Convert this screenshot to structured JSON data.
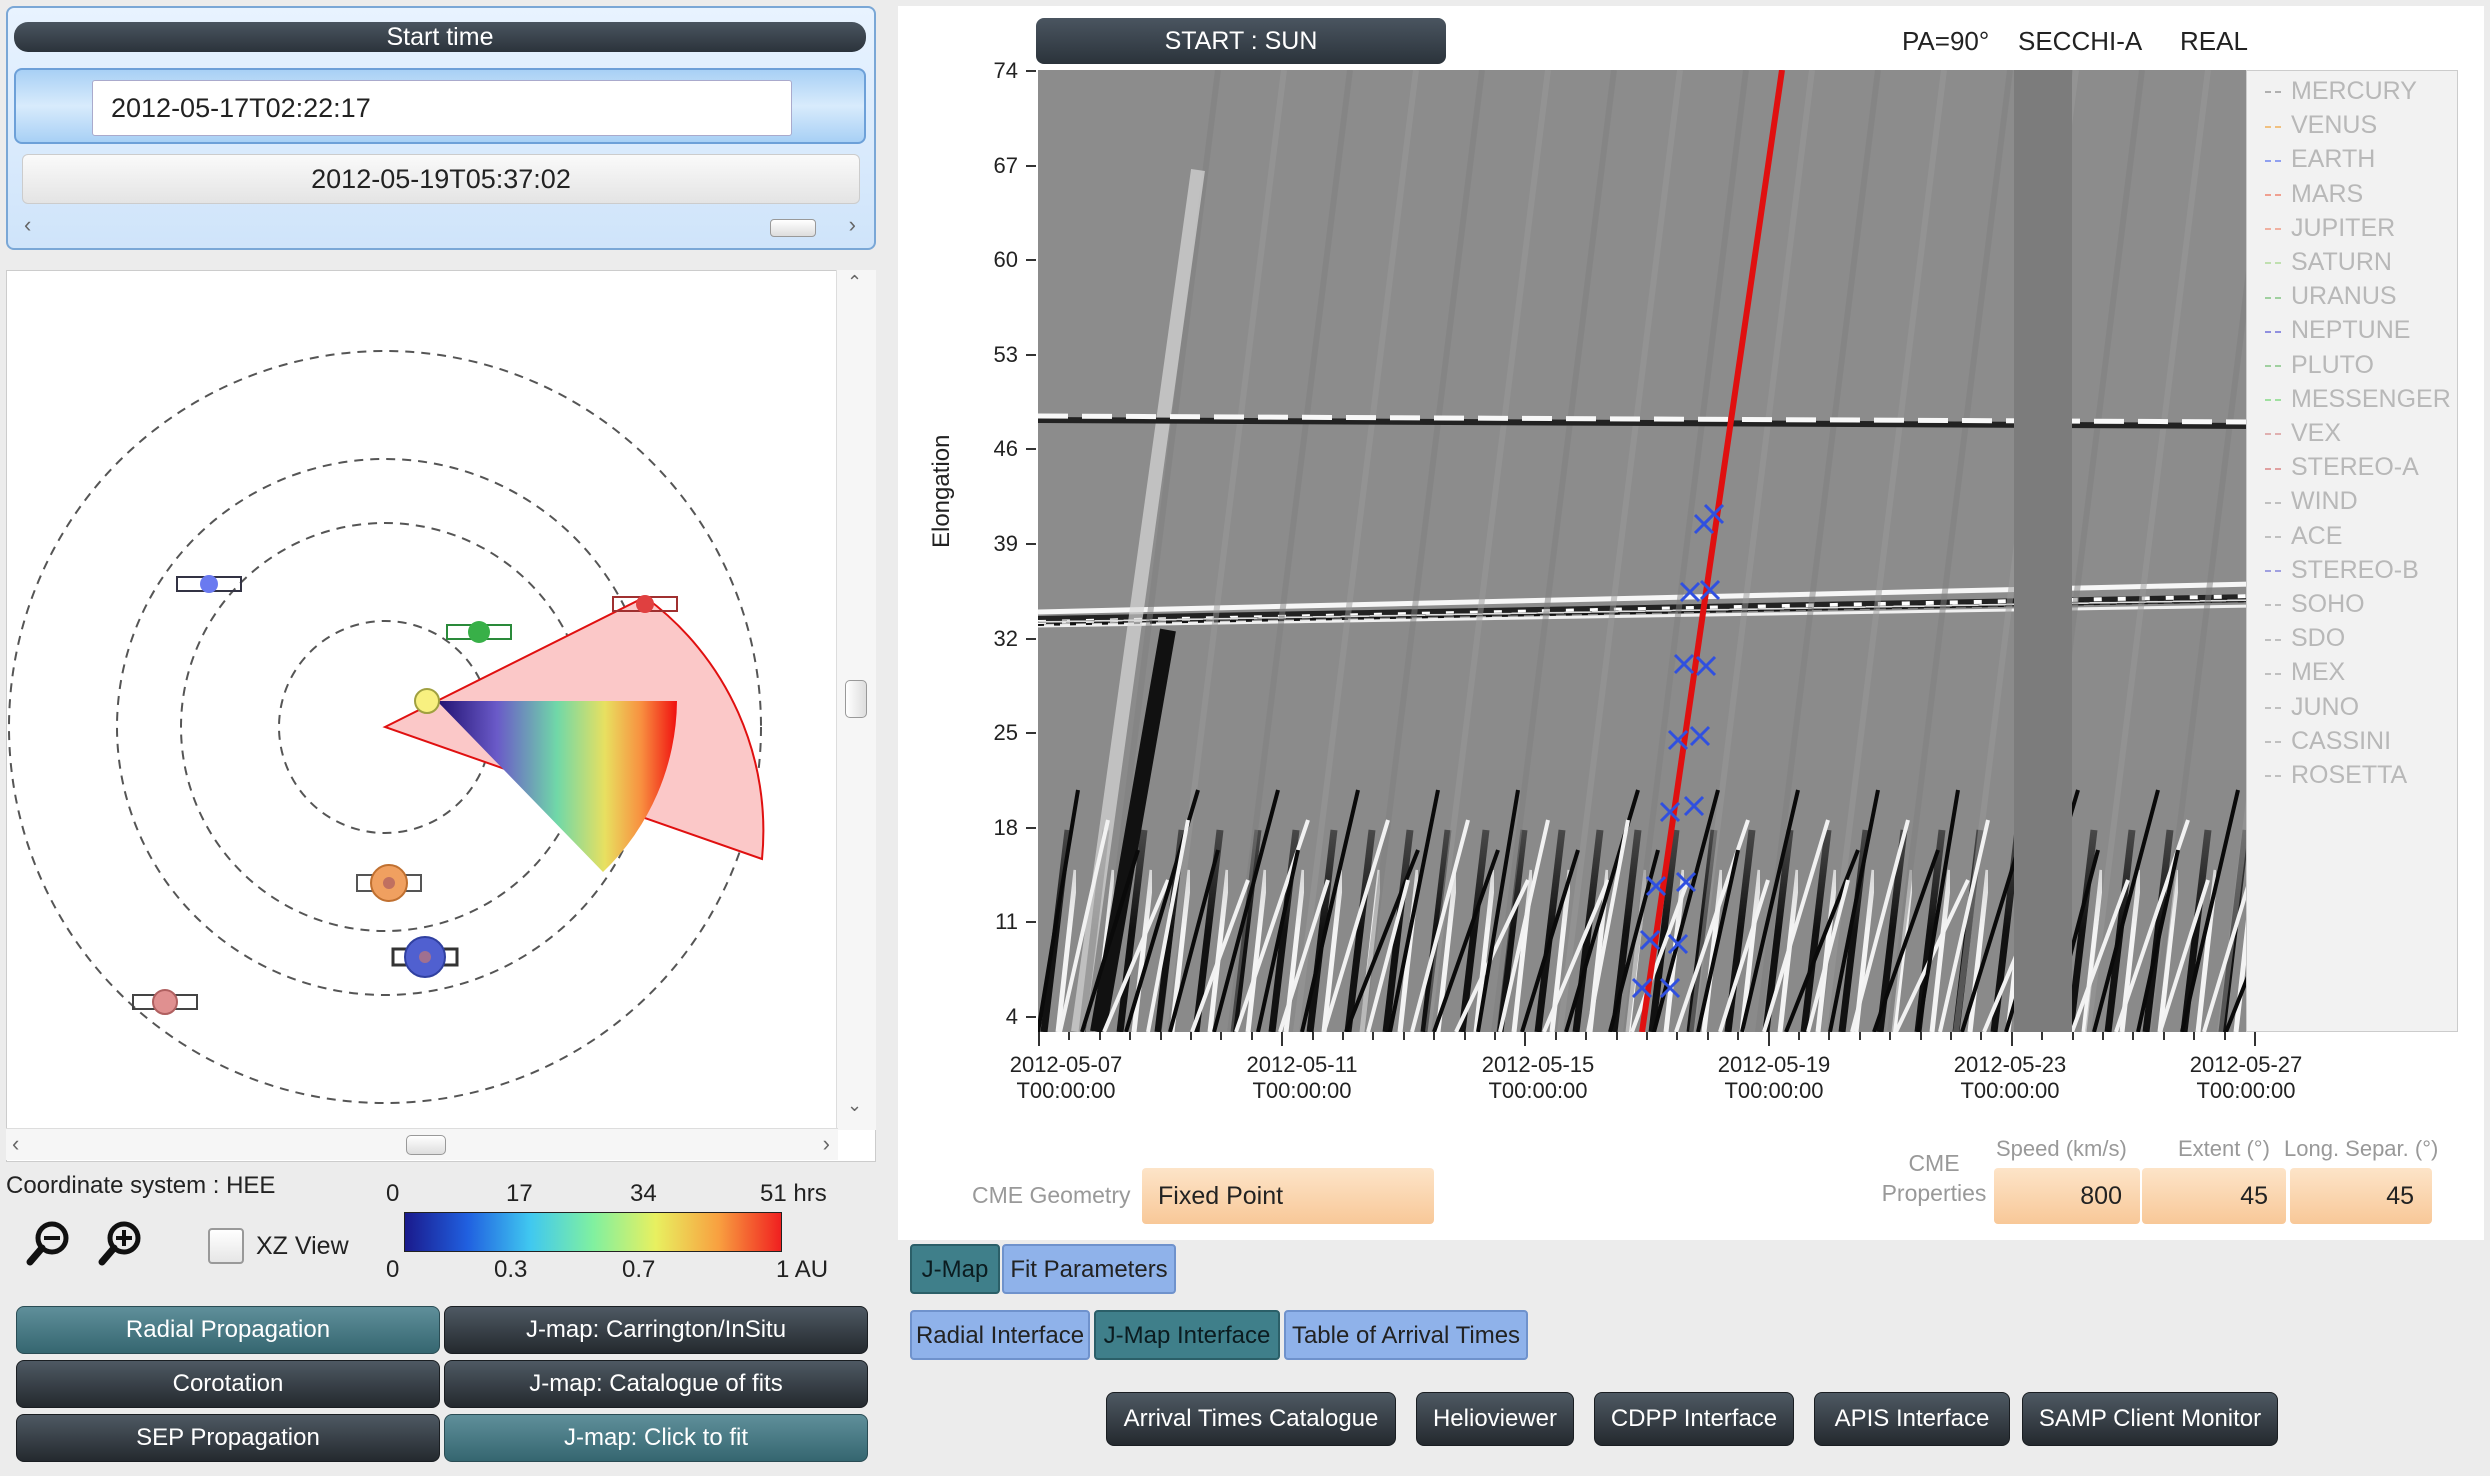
{
  "time_panel": {
    "start_label": "Start time",
    "start_value": "2012-05-17T02:22:17",
    "end_value": "2012-05-19T05:37:02"
  },
  "orbit_view": {
    "coordinate_system": "Coordinate system : HEE",
    "xz_view_label": "XZ View",
    "xz_view_checked": false,
    "colorbar": {
      "top_ticks": [
        "0",
        "17",
        "34",
        "51 hrs"
      ],
      "bottom_ticks": [
        "0",
        "0.3",
        "0.7",
        "1 AU"
      ],
      "colors": [
        "#1a1a8c",
        "#2060e0",
        "#40c8f0",
        "#80f0a0",
        "#e8f060",
        "#f8a040",
        "#f02020"
      ]
    }
  },
  "left_buttons": {
    "radial_propagation": "Radial Propagation",
    "corotation": "Corotation",
    "sep_propagation": "SEP Propagation",
    "jmap_carrington": "J-map: Carrington/InSitu",
    "jmap_catalogue": "J-map: Catalogue of fits",
    "jmap_click": "J-map: Click to fit"
  },
  "jmap": {
    "start_button": "START : SUN",
    "pa": "PA=90°",
    "instrument": "SECCHI-A",
    "mode": "REAL",
    "ylabel": "Elongation",
    "yticks": [
      "74",
      "67",
      "60",
      "53",
      "46",
      "39",
      "32",
      "25",
      "18",
      "11",
      "4"
    ],
    "xticks": [
      {
        "date": "2012-05-07",
        "time": "T00:00:00"
      },
      {
        "date": "2012-05-11",
        "time": "T00:00:00"
      },
      {
        "date": "2012-05-15",
        "time": "T00:00:00"
      },
      {
        "date": "2012-05-19",
        "time": "T00:00:00"
      },
      {
        "date": "2012-05-23",
        "time": "T00:00:00"
      },
      {
        "date": "2012-05-27",
        "time": "T00:00:00"
      }
    ],
    "legend": [
      {
        "name": "MERCURY",
        "color": "#b0b0b0"
      },
      {
        "name": "VENUS",
        "color": "#f0c080"
      },
      {
        "name": "EARTH",
        "color": "#90a0f0"
      },
      {
        "name": "MARS",
        "color": "#f0a090"
      },
      {
        "name": "JUPITER",
        "color": "#f0b0a0"
      },
      {
        "name": "SATURN",
        "color": "#c0e0b0"
      },
      {
        "name": "URANUS",
        "color": "#a0d0a0"
      },
      {
        "name": "NEPTUNE",
        "color": "#9090e0"
      },
      {
        "name": "PLUTO",
        "color": "#a0d0a0"
      },
      {
        "name": "MESSENGER",
        "color": "#a0e0a0"
      },
      {
        "name": "VEX",
        "color": "#e0b0b0"
      },
      {
        "name": "STEREO-A",
        "color": "#e0a0a0"
      },
      {
        "name": "WIND",
        "color": "#c0c0c0"
      },
      {
        "name": "ACE",
        "color": "#c0c0c0"
      },
      {
        "name": "STEREO-B",
        "color": "#a0a0e0"
      },
      {
        "name": "SOHO",
        "color": "#c0c0c0"
      },
      {
        "name": "SDO",
        "color": "#c0c0c0"
      },
      {
        "name": "MEX",
        "color": "#c0c0c0"
      },
      {
        "name": "JUNO",
        "color": "#c0c0c0"
      },
      {
        "name": "CASSINI",
        "color": "#c0c0c0"
      },
      {
        "name": "ROSETTA",
        "color": "#c0c0c0"
      }
    ]
  },
  "cme": {
    "geometry_label": "CME Geometry",
    "geometry_value": "Fixed Point",
    "properties_label_1": "CME",
    "properties_label_2": "Properties",
    "speed_label": "Speed (km/s)",
    "extent_label": "Extent (°)",
    "separation_label": "Long. Separ. (°)",
    "speed": "800",
    "extent": "45",
    "separation": "45"
  },
  "tabs": {
    "jmap": "J-Map",
    "fit_parameters": "Fit Parameters",
    "radial_interface": "Radial Interface",
    "jmap_interface": "J-Map Interface",
    "arrival_table": "Table of Arrival Times"
  },
  "bottom_buttons": {
    "arrival_catalogue": "Arrival Times Catalogue",
    "helioviewer": "Helioviewer",
    "cdpp": "CDPP Interface",
    "apis": "APIS Interface",
    "samp": "SAMP Client Monitor"
  }
}
